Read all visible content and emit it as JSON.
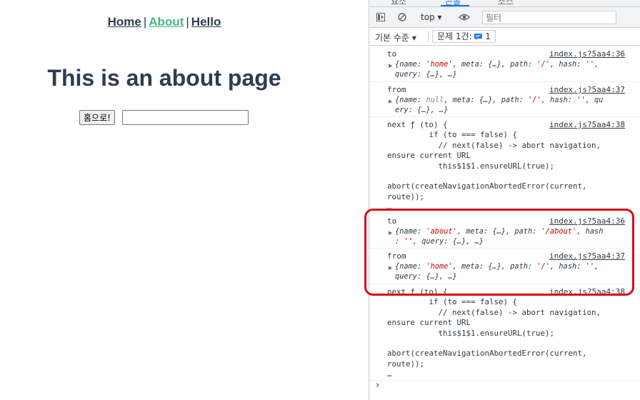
{
  "app": {
    "nav": {
      "home": "Home",
      "about": "About",
      "hello": "Hello",
      "separator": "|"
    },
    "title": "This is an about page",
    "home_button": "홈으로!",
    "input_value": ""
  },
  "devtools": {
    "tabs": [
      "요소",
      "콘솔",
      "소스"
    ],
    "toolbar": {
      "context": "top",
      "filter_placeholder": "필터"
    },
    "status": {
      "levels": "기본 수준",
      "issues": "문제 1건:",
      "issues_count": "1"
    },
    "messages": [
      {
        "label": "to",
        "source": "index.js?5aa4:36",
        "object": "{name: 'home', meta: {…}, path: '/', hash: '', query: {…}, …}"
      },
      {
        "label": "from",
        "source": "index.js?5aa4:37",
        "object": "{name: null, meta: {…}, path: '/', hash: '', query: {…}, …}"
      },
      {
        "label": "next",
        "source": "index.js?5aa4:38",
        "code": "next ƒ (to) {\n         if (to === false) {\n           // next(false) -> abort navigation,\nensure current URL\n           this$1$1.ensureURL(true);\n\nabort(createNavigationAbortedError(current,\nroute));\n…"
      },
      {
        "label": "to",
        "source": "index.js?5aa4:36",
        "object": "{name: 'about', meta: {…}, path: '/about', hash: '', query: {…}, …}"
      },
      {
        "label": "from",
        "source": "index.js?5aa4:37",
        "object": "{name: 'home', meta: {…}, path: '/', hash: '', query: {…}, …}"
      },
      {
        "label": "next",
        "source": "index.js?5aa4:38",
        "code": "next ƒ (to) {\n         if (to === false) {\n           // next(false) -> abort navigation,\nensure current URL\n           this$1$1.ensureURL(true);\n\nabort(createNavigationAbortedError(current,\nroute));\n…"
      }
    ],
    "prompt": "›"
  },
  "colors": {
    "link_active": "#42b983",
    "text": "#2c3e50",
    "highlight": "#d60e1a",
    "devtools_accent": "#1a73e8"
  }
}
